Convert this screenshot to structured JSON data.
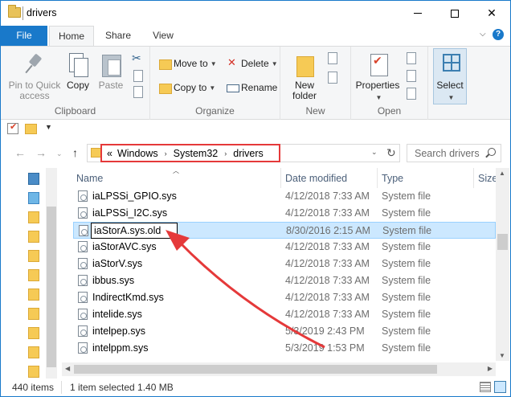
{
  "window": {
    "title": "drivers",
    "minimize_glyph": "—",
    "close_glyph": "✕"
  },
  "ribbon_tabs": [
    {
      "label": "File"
    },
    {
      "label": "Home"
    },
    {
      "label": "Share"
    },
    {
      "label": "View"
    }
  ],
  "ribbon": {
    "clipboard": {
      "label": "Clipboard",
      "pin_label": "Pin to Quick access",
      "copy_label": "Copy",
      "paste_label": "Paste"
    },
    "organize": {
      "label": "Organize",
      "move_to": "Move to",
      "copy_to": "Copy to",
      "delete": "Delete",
      "rename": "Rename"
    },
    "new": {
      "label": "New",
      "new_folder": "New folder"
    },
    "open": {
      "label": "Open",
      "properties": "Properties"
    },
    "select": {
      "label": "Select"
    }
  },
  "address_bar": {
    "overflow": "«",
    "crumbs": [
      "Windows",
      "System32",
      "drivers"
    ],
    "crumb_separator": "›"
  },
  "search": {
    "placeholder": "Search drivers"
  },
  "columns": {
    "name": "Name",
    "date": "Date modified",
    "type": "Type",
    "size": "Size"
  },
  "files": [
    {
      "name": "iaLPSSi_GPIO.sys",
      "date": "4/12/2018 7:33 AM",
      "type": "System file",
      "selected": false
    },
    {
      "name": "iaLPSSi_I2C.sys",
      "date": "4/12/2018 7:33 AM",
      "type": "System file",
      "selected": false
    },
    {
      "name": "iaStorA.sys.old",
      "date": "8/30/2016 2:15 AM",
      "type": "System file",
      "selected": true
    },
    {
      "name": "iaStorAVC.sys",
      "date": "4/12/2018 7:33 AM",
      "type": "System file",
      "selected": false
    },
    {
      "name": "iaStorV.sys",
      "date": "4/12/2018 7:33 AM",
      "type": "System file",
      "selected": false
    },
    {
      "name": "ibbus.sys",
      "date": "4/12/2018 7:33 AM",
      "type": "System file",
      "selected": false
    },
    {
      "name": "IndirectKmd.sys",
      "date": "4/12/2018 7:33 AM",
      "type": "System file",
      "selected": false
    },
    {
      "name": "intelide.sys",
      "date": "4/12/2018 7:33 AM",
      "type": "System file",
      "selected": false
    },
    {
      "name": "intelpep.sys",
      "date": "5/3/2019 2:43 PM",
      "type": "System file",
      "selected": false
    },
    {
      "name": "intelppm.sys",
      "date": "5/3/2019 1:53 PM",
      "type": "System file",
      "selected": false
    }
  ],
  "status": {
    "item_count": "440 items",
    "selection": "1 item selected  1.40 MB"
  },
  "colors": {
    "accent": "#1979ca",
    "selection": "#cce8ff",
    "annotation": "#e5393a"
  }
}
